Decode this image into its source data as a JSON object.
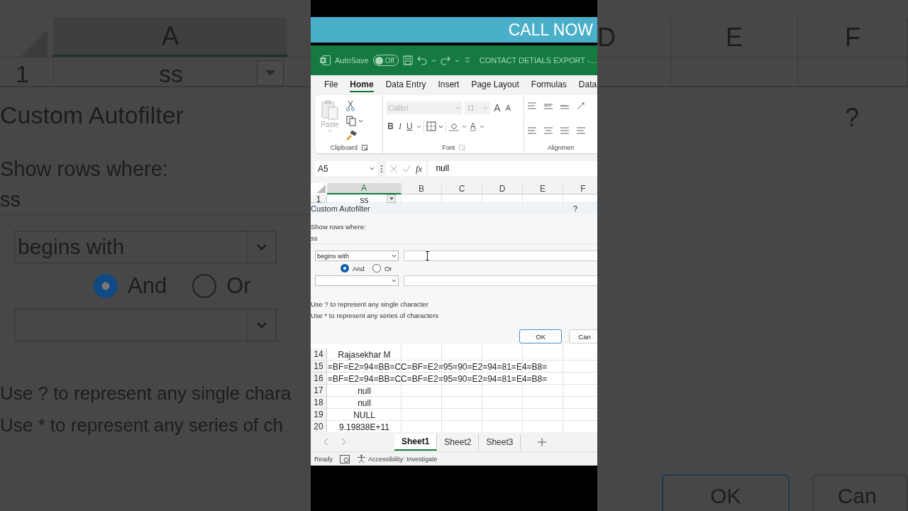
{
  "backdrop_left": {
    "column": "A",
    "row_number": "1",
    "cell": "ss",
    "title": "Custom Autofilter",
    "prompt": "Show rows where:",
    "field": "ss",
    "operator": "begins with",
    "radios": [
      {
        "label": "And",
        "selected": true
      },
      {
        "label": "Or",
        "selected": false
      }
    ],
    "hints": [
      "Use ? to represent any single chara",
      "Use * to represent any series of ch"
    ]
  },
  "backdrop_right": {
    "columns": [
      "D",
      "E",
      "F"
    ],
    "help": "?",
    "buttons": [
      "OK",
      "Can"
    ]
  },
  "banner": {
    "text": "CALL NOW"
  },
  "title_bar": {
    "autosave_label": "AutoSave",
    "autosave": {
      "on": false,
      "label": "Off"
    },
    "document_title": "CONTACT DETIALS EXPORT -..."
  },
  "ribbon_tabs": [
    {
      "label": "File",
      "selected": false
    },
    {
      "label": "Home",
      "selected": true
    },
    {
      "label": "Data Entry",
      "selected": false
    },
    {
      "label": "Insert",
      "selected": false
    },
    {
      "label": "Page Layout",
      "selected": false
    },
    {
      "label": "Formulas",
      "selected": false
    },
    {
      "label": "Data",
      "selected": false
    }
  ],
  "ribbon": {
    "clipboard": {
      "paste_label": "Paste",
      "group_label": "Clipboard"
    },
    "font": {
      "font_name": "Calibri",
      "font_size": "11",
      "grow": "A",
      "shrink": "A",
      "bold": "B",
      "italic": "I",
      "underline": "U",
      "font_color": "A",
      "group_label": "Font"
    },
    "alignment": {
      "group_label": "Alignmen"
    }
  },
  "formula_bar": {
    "name_box": "A5",
    "fx": "fx",
    "value": "null"
  },
  "sheet": {
    "columns": [
      {
        "label": "A",
        "selected": true
      },
      {
        "label": "B",
        "selected": false
      },
      {
        "label": "C",
        "selected": false
      },
      {
        "label": "D",
        "selected": false
      },
      {
        "label": "E",
        "selected": false
      },
      {
        "label": "F",
        "selected": false
      }
    ],
    "header_row": {
      "number": "1",
      "value": "ss",
      "filter": true
    },
    "rows": [
      {
        "number": "14",
        "value": "Rajasekhar M",
        "kind": "centered"
      },
      {
        "number": "15",
        "value": "=BF=E2=94=BB=CC=BF=E2=95=90=E2=94=81=E4=B8=",
        "kind": "overflow"
      },
      {
        "number": "16",
        "value": "=BF=E2=94=BB=CC=BF=E2=95=90=E2=94=81=E4=B8=",
        "kind": "overflow"
      },
      {
        "number": "17",
        "value": "null",
        "kind": "centered"
      },
      {
        "number": "18",
        "value": "null",
        "kind": "centered"
      },
      {
        "number": "19",
        "value": "NULL",
        "kind": "centered"
      },
      {
        "number": "20",
        "value": "9.19838E+11",
        "kind": "centered"
      }
    ]
  },
  "dialog": {
    "title": "Custom Autofilter",
    "help": "?",
    "prompt": "Show rows where:",
    "field": "ss",
    "conditions": [
      {
        "kind": "filled",
        "operator": "begins with"
      },
      {
        "kind": "blank"
      }
    ],
    "radios": [
      {
        "label": "And",
        "selected": true
      },
      {
        "label": "Or",
        "selected": false
      }
    ],
    "hints": [
      "Use ? to represent any single character",
      "Use * to represent any series of characters"
    ],
    "buttons": [
      "OK",
      "Can"
    ]
  },
  "sheet_tabs": [
    {
      "label": "Sheet1",
      "selected": true
    },
    {
      "label": "Sheet2",
      "selected": false
    },
    {
      "label": "Sheet3",
      "selected": false
    }
  ],
  "status_bar": {
    "status": "Ready",
    "accessibility": "Accessibility: Investigate"
  }
}
